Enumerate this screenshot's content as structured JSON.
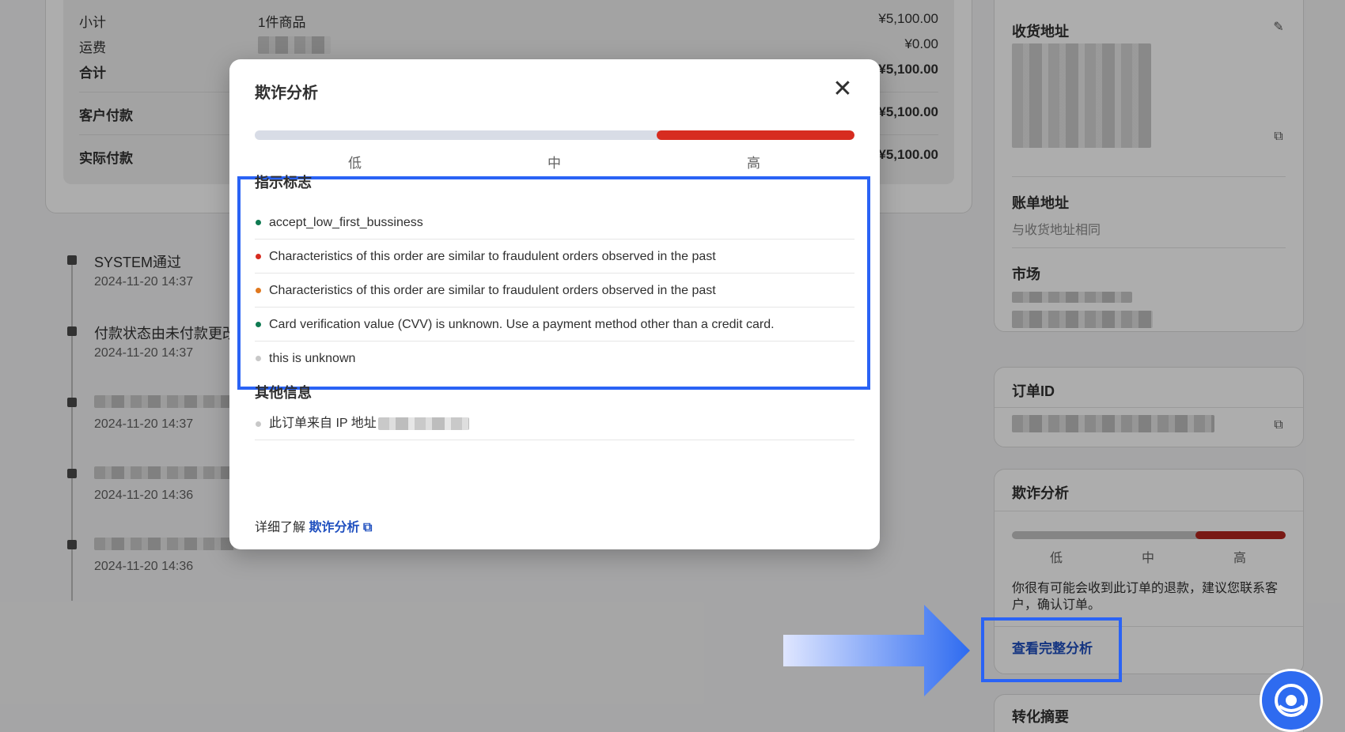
{
  "colors": {
    "accent": "#2a63f5",
    "risk_high": "#d72c20",
    "link": "#1f4fbf",
    "dot_green": "#0f7a52",
    "dot_red": "#d72c20",
    "dot_orange": "#e0781e",
    "dot_gray": "#c8c8c8"
  },
  "summary": {
    "subtotal_label": "小计",
    "subtotal_items": "1件商品",
    "subtotal_value": "¥5,100.00",
    "shipping_label": "运费",
    "shipping_value": "¥0.00",
    "total_label": "合计",
    "total_value": "¥5,100.00",
    "customer_paid_label": "客户付款",
    "customer_paid_value": "¥5,100.00",
    "actual_paid_label": "实际付款",
    "actual_paid_value": "¥5,100.00"
  },
  "timeline": [
    {
      "title": "SYSTEM通过",
      "time": "2024-11-20 14:37"
    },
    {
      "title": "付款状态由未付款更改",
      "time": "2024-11-20 14:37"
    },
    {
      "title": "",
      "time": "2024-11-20 14:37"
    },
    {
      "title": "",
      "time": "2024-11-20 14:36"
    },
    {
      "title": "",
      "time": "2024-11-20 14:36"
    }
  ],
  "sidebar": {
    "shipping_address_title": "收货地址",
    "billing_address_title": "账单地址",
    "billing_address_value": "与收货地址相同",
    "market_title": "市场",
    "order_id_title": "订单ID",
    "fraud_title": "欺诈分析",
    "levels": [
      "低",
      "中",
      "高"
    ],
    "risk_level": 0.67,
    "advice": "你很有可能会收到此订单的退款，建议您联系客户，确认订单。",
    "full_analysis_link": "查看完整分析",
    "conversion_title": "转化摘要"
  },
  "modal": {
    "title": "欺诈分析",
    "close_icon": "close-icon",
    "risk_level": 0.67,
    "levels": [
      "低",
      "中",
      "高"
    ],
    "indicators_title": "指示标志",
    "indicators": [
      {
        "text": "accept_low_first_bussiness",
        "status": "green"
      },
      {
        "text": "Characteristics of this order are similar to fraudulent orders observed in the past",
        "status": "red"
      },
      {
        "text": "Characteristics of this order are similar to fraudulent orders observed in the past",
        "status": "orange"
      },
      {
        "text": "Card verification value (CVV) is unknown. Use a payment method other than a credit card.",
        "status": "green"
      },
      {
        "text": "this is unknown",
        "status": "gray"
      }
    ],
    "other_info_title": "其他信息",
    "ip_label": "此订单来自 IP 地址",
    "learn_prefix": "详细了解",
    "learn_link": "欺诈分析",
    "external_icon": "external-link-icon"
  },
  "help_icon": "support-chat-icon"
}
